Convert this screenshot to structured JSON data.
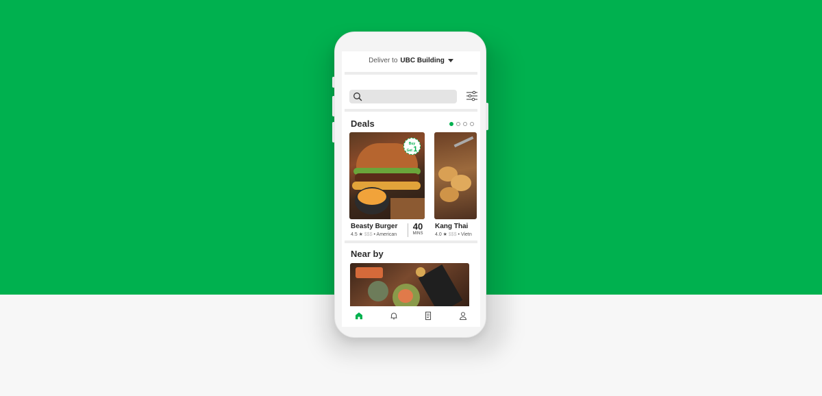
{
  "header": {
    "deliver_label": "Deliver to",
    "location": "UBC Building"
  },
  "deals": {
    "title": "Deals",
    "carousel_pages": 4,
    "carousel_active_index": 0,
    "cards": [
      {
        "name": "Beasty Burger",
        "rating": "4.5 ★",
        "price_level": "$$$",
        "cuisine": "• American",
        "eta_value": "40",
        "eta_unit": "MINS",
        "promo_badge_top": "Buy",
        "promo_badge_mid": "Get",
        "promo_badge_num": "1"
      },
      {
        "name": "Kang Thai",
        "rating": "4.0 ★",
        "price_level": "$$$",
        "cuisine": "• Vietn"
      }
    ]
  },
  "nearby": {
    "title": "Near by"
  },
  "nav": {
    "items": [
      "home-icon",
      "bell-icon",
      "receipt-icon",
      "profile-icon"
    ],
    "active": "home-icon"
  },
  "colors": {
    "brand_green": "#00b14f",
    "text_dark": "#222222"
  }
}
